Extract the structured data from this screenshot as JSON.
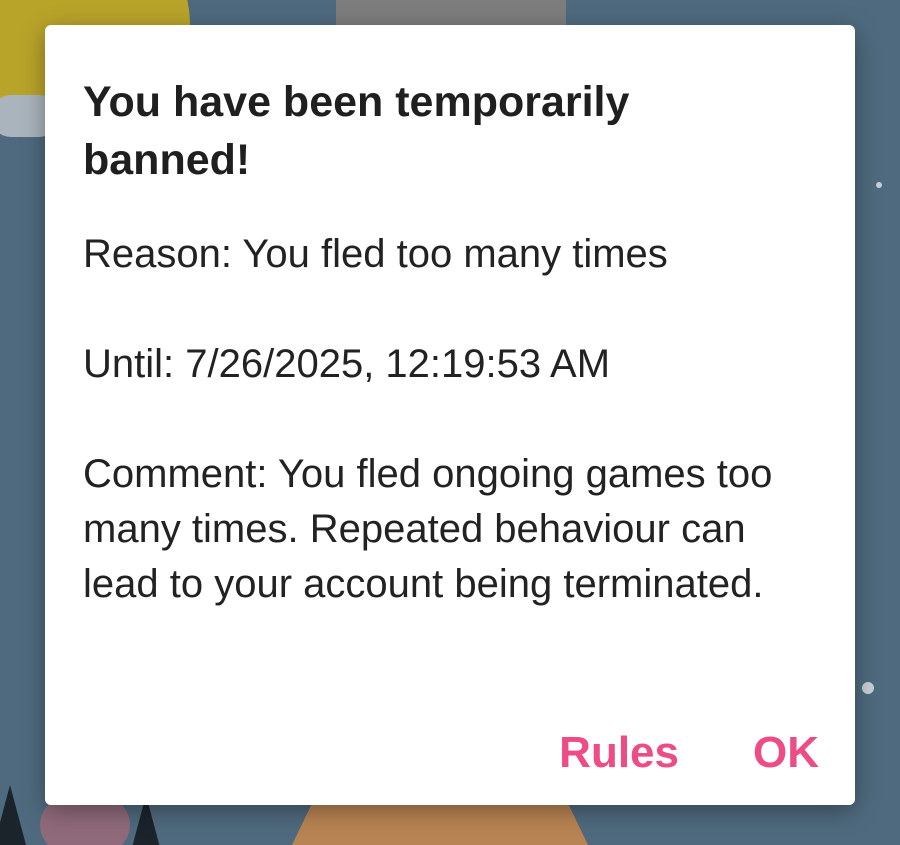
{
  "dialog": {
    "title": "You have been temporarily banned!",
    "reason": "Reason: You fled too many times",
    "until": "Until: 7/26/2025, 12:19:53 AM",
    "comment": "Comment: You fled ongoing games too many times. Repeated behaviour can lead to your account being terminated.",
    "buttons": {
      "rules": "Rules",
      "ok": "OK"
    }
  },
  "colors": {
    "accent": "#ec4d85",
    "backdrop": "#4f6a7e",
    "dialog_bg": "#ffffff",
    "title_text": "#1f1f1f",
    "body_text": "#222222"
  }
}
